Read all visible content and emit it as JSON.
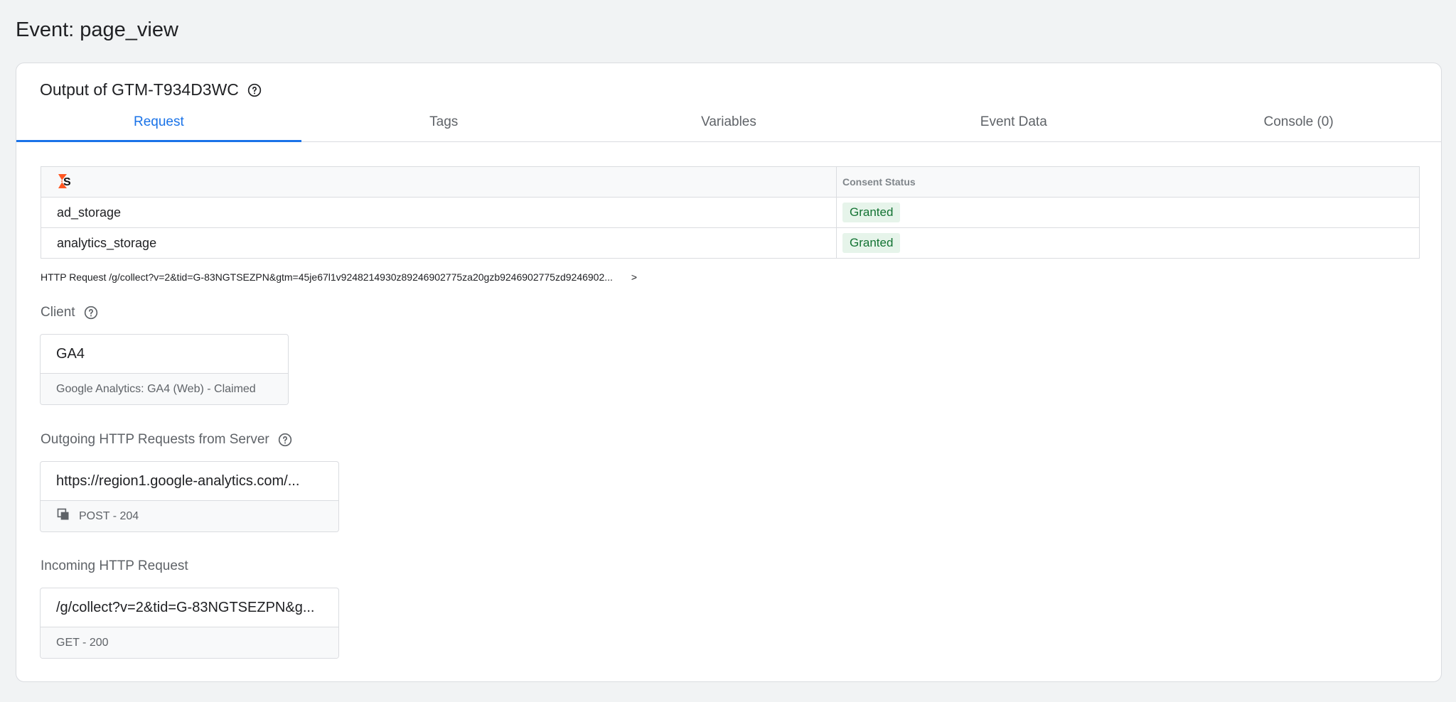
{
  "page": {
    "title": "Event: page_view"
  },
  "card": {
    "title": "Output of GTM-T934D3WC",
    "tabs": [
      {
        "label": "Request",
        "active": true
      },
      {
        "label": "Tags",
        "active": false
      },
      {
        "label": "Variables",
        "active": false
      },
      {
        "label": "Event Data",
        "active": false
      },
      {
        "label": "Console (0)",
        "active": false
      }
    ]
  },
  "consent": {
    "header_status": "Consent Status",
    "rows": [
      {
        "key": "ad_storage",
        "status": "Granted"
      },
      {
        "key": "analytics_storage",
        "status": "Granted"
      }
    ]
  },
  "http_request": {
    "text": "HTTP Request /g/collect?v=2&tid=G-83NGTSEZPN&gtm=45je67l1v9248214930z89246902775za20gzb9246902775zd9246902...",
    "chevron": ">"
  },
  "client": {
    "label": "Client",
    "name": "GA4",
    "detail": "Google Analytics: GA4 (Web) - Claimed"
  },
  "outgoing": {
    "label": "Outgoing HTTP Requests from Server",
    "url": "https://region1.google-analytics.com/...",
    "detail": "POST - 204"
  },
  "incoming": {
    "label": "Incoming HTTP Request",
    "url": "/g/collect?v=2&tid=G-83NGTSEZPN&g...",
    "detail": "GET - 200"
  },
  "colors": {
    "accent": "#1a73e8",
    "granted_bg": "#e6f4ea",
    "granted_text": "#137333",
    "logo_orange": "#ff5722"
  }
}
